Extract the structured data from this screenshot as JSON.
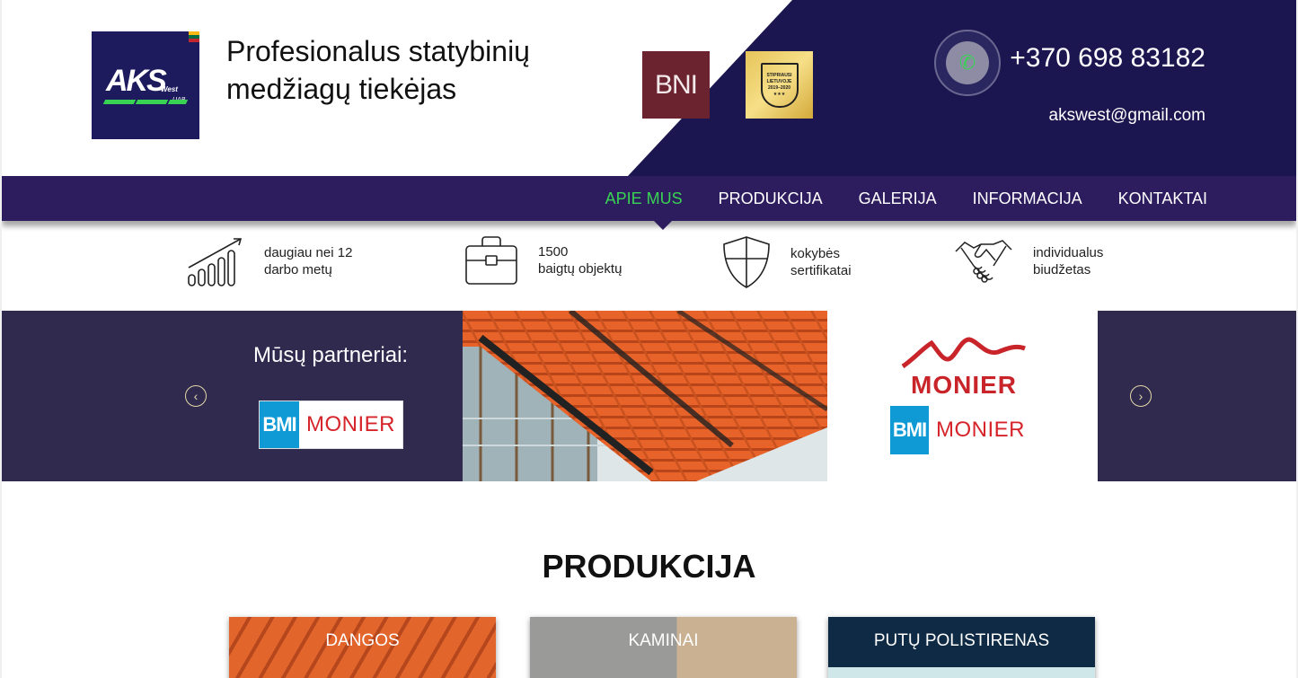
{
  "header": {
    "logo_text": "AKS",
    "logo_sub": "West",
    "logo_uab": "UAB",
    "tagline": "Profesionalus statybinių medžiagų tiekėjas",
    "badge_bni": "BNI",
    "badge_strong_lines": [
      "STIPRIAUSI",
      "LIETUVOJE",
      "2019–2020",
      "★★★"
    ],
    "phone": "+370 698 83182",
    "email": "akswest@gmail.com"
  },
  "nav": {
    "items": [
      {
        "label": "APIE MUS",
        "active": true
      },
      {
        "label": "PRODUKCIJA",
        "active": false
      },
      {
        "label": "GALERIJA",
        "active": false
      },
      {
        "label": "INFORMACIJA",
        "active": false
      },
      {
        "label": "KONTAKTAI",
        "active": false
      }
    ]
  },
  "features": [
    {
      "icon": "bar-chart-icon",
      "line1": "daugiau nei 12",
      "line2": "darbo metų"
    },
    {
      "icon": "briefcase-icon",
      "line1": "1500",
      "line2": "baigtų objektų"
    },
    {
      "icon": "shield-icon",
      "line1": "kokybės",
      "line2": "sertifikatai"
    },
    {
      "icon": "handshake-icon",
      "line1": "individualus",
      "line2": "biudžetas"
    }
  ],
  "partners": {
    "title": "Mūsų partneriai:",
    "bmi": "BMI",
    "monier": "MONIER"
  },
  "products": {
    "title": "PRODUKCIJA",
    "cards": [
      "DANGOS",
      "KAMINAI",
      "PUTŲ POLISTIRENAS"
    ]
  },
  "colors": {
    "dark_navy": "#1b1650",
    "nav_purple": "#2d1c5e",
    "accent_green": "#39d353",
    "band": "#2f2a4e",
    "monier_red": "#c8242a",
    "bmi_blue": "#0f9ad6"
  }
}
